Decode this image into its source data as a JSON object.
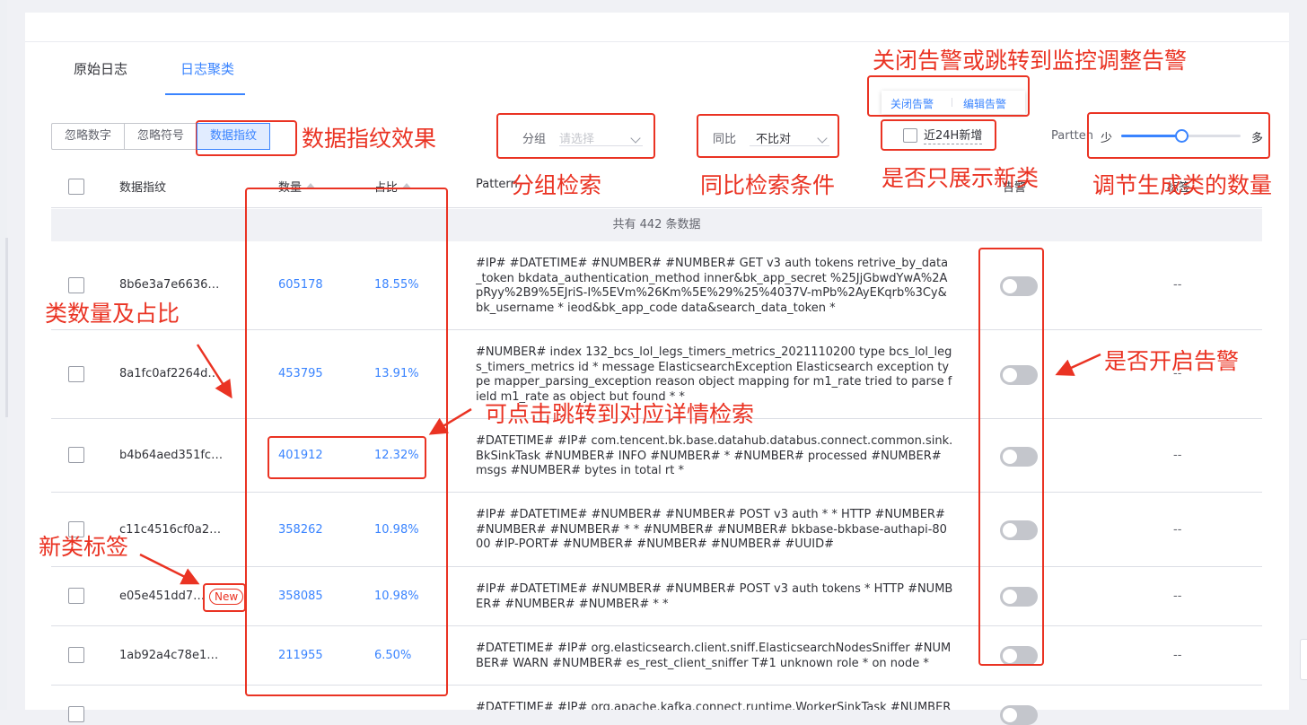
{
  "tabs": {
    "raw_log": "原始日志",
    "log_cluster": "日志聚类"
  },
  "toolbar": {
    "ignore_numbers": "忽略数字",
    "ignore_symbols": "忽略符号",
    "data_fingerprint": "数据指纹",
    "group_label": "分组",
    "group_placeholder": "请选择",
    "compare_label": "同比",
    "compare_value": "不比对",
    "new24h_label": "近24H新增",
    "pattern_label": "Partten",
    "slider_min": "少",
    "slider_max": "多",
    "slider_level": 0.5
  },
  "alarm_actions": {
    "close_alarm": "关闭告警",
    "edit_alarm": "编辑告警"
  },
  "table": {
    "headers": {
      "fingerprint": "数据指纹",
      "count": "数量",
      "percent": "占比",
      "pattern": "Pattern",
      "alarm": "告警",
      "tag": "标签"
    },
    "total_text": "共有 442 条数据",
    "rows": [
      {
        "fp": "8b6e3a7e6636…",
        "count": "605178",
        "pct": "18.55%",
        "pattern": "#IP# #DATETIME# #NUMBER# #NUMBER# GET v3 auth tokens retrive_by_data_token bkdata_authentication_method inner&bk_app_secret %25JjGbwdYwA%2ApRyy%2B9%5EJriS-I%5EVm%26Km%5E%29%25%4037V-mPb%2AyEKqrb%3Cy&bk_username * ieod&bk_app_code data&search_data_token *",
        "tag": "--"
      },
      {
        "fp": "8a1fc0af2264d…",
        "count": "453795",
        "pct": "13.91%",
        "pattern": "#NUMBER# index 132_bcs_lol_legs_timers_metrics_2021110200 type bcs_lol_legs_timers_metrics id * message ElasticsearchException Elasticsearch exception type mapper_parsing_exception reason object mapping for m1_rate tried to parse field m1_rate as object but found * *",
        "tag": "--"
      },
      {
        "fp": "b4b64aed351fc…",
        "count": "401912",
        "pct": "12.32%",
        "pattern": "#DATETIME# #IP# com.tencent.bk.base.datahub.databus.connect.common.sink.BkSinkTask #NUMBER# INFO #NUMBER# * #NUMBER# processed #NUMBER# msgs #NUMBER# bytes in total rt *",
        "tag": "--"
      },
      {
        "fp": "c11c4516cf0a2…",
        "count": "358262",
        "pct": "10.98%",
        "pattern": "#IP# #DATETIME# #NUMBER# #NUMBER# POST v3 auth * * HTTP #NUMBER# #NUMBER# #NUMBER# * * #NUMBER# #NUMBER# bkbase-bkbase-authapi-8000 #IP-PORT# #NUMBER# #NUMBER# #NUMBER# #UUID#",
        "tag": "--"
      },
      {
        "fp": "e05e451dd7…",
        "count": "358085",
        "pct": "10.98%",
        "pattern": "#IP# #DATETIME# #NUMBER# #NUMBER# POST v3 auth tokens * HTTP #NUMBER# #NUMBER# #NUMBER# * *",
        "tag": "--",
        "new_tag": "New"
      },
      {
        "fp": "1ab92a4c78e1…",
        "count": "211955",
        "pct": "6.50%",
        "pattern": "#DATETIME# #IP# org.elasticsearch.client.sniff.ElasticsearchNodesSniffer #NUMBER# WARN #NUMBER# es_rest_client_sniffer T#1 unknown role * on node *",
        "tag": "--"
      },
      {
        "fp": "",
        "count": "",
        "pct": "",
        "pattern": "#DATETIME# #IP# org.apache.kafka.connect.runtime.WorkerSinkTask #NUMBER#",
        "tag": ""
      }
    ]
  },
  "annotations": {
    "alarm_close_jump": "关闭告警或跳转到监控调整告警",
    "fingerprint_effect": "数据指纹效果",
    "group_search": "分组检索",
    "compare_condition": "同比检索条件",
    "only_new": "是否只展示新类",
    "adjust_count": "调节生成类的数量",
    "count_ratio": "类数量及占比",
    "enable_alarm": "是否开启告警",
    "click_jump": "可点击跳转到对应详情检索",
    "new_tag": "新类标签"
  },
  "colors": {
    "accent": "#3a84ff",
    "annotation": "#ea3323",
    "switch_off": "#c4c6cc"
  }
}
